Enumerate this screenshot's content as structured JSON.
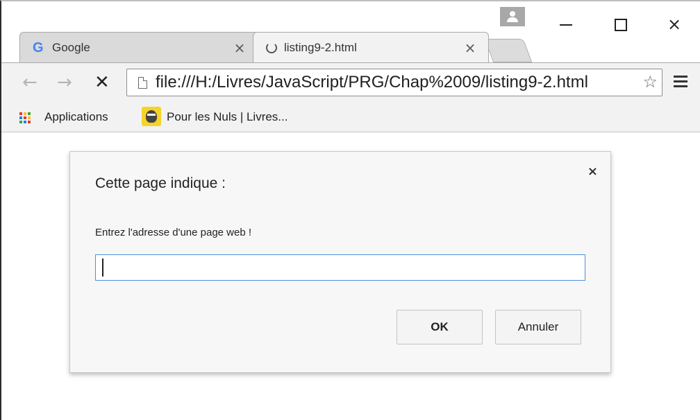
{
  "tabs": [
    {
      "title": "Google",
      "favicon": "google-g-icon",
      "close": "×"
    },
    {
      "title": "listing9-2.html",
      "favicon": "loading-spinner-icon",
      "close": "×"
    }
  ],
  "window_controls": {
    "minimize": "minimize-icon",
    "maximize": "maximize-icon",
    "close": "×"
  },
  "toolbar": {
    "back": "←",
    "forward": "→",
    "stop": "✕",
    "url": "file:///H:/Livres/JavaScript/PRG/Chap%2009/listing9-2.html",
    "star": "☆"
  },
  "bookmarks": [
    {
      "label": "Applications",
      "icon": "apps-grid-icon"
    },
    {
      "label": "Pour les Nuls | Livres...",
      "icon": "pour-les-nuls-icon"
    }
  ],
  "dialog": {
    "title": "Cette page indique :",
    "message": "Entrez l'adresse d'une page web !",
    "input_value": "",
    "close": "×",
    "ok_label": "OK",
    "cancel_label": "Annuler"
  },
  "colors": {
    "google_blue": "#4285f4",
    "input_focus_border": "#4a90d9",
    "chrome_frame": "#f2f2f2"
  }
}
